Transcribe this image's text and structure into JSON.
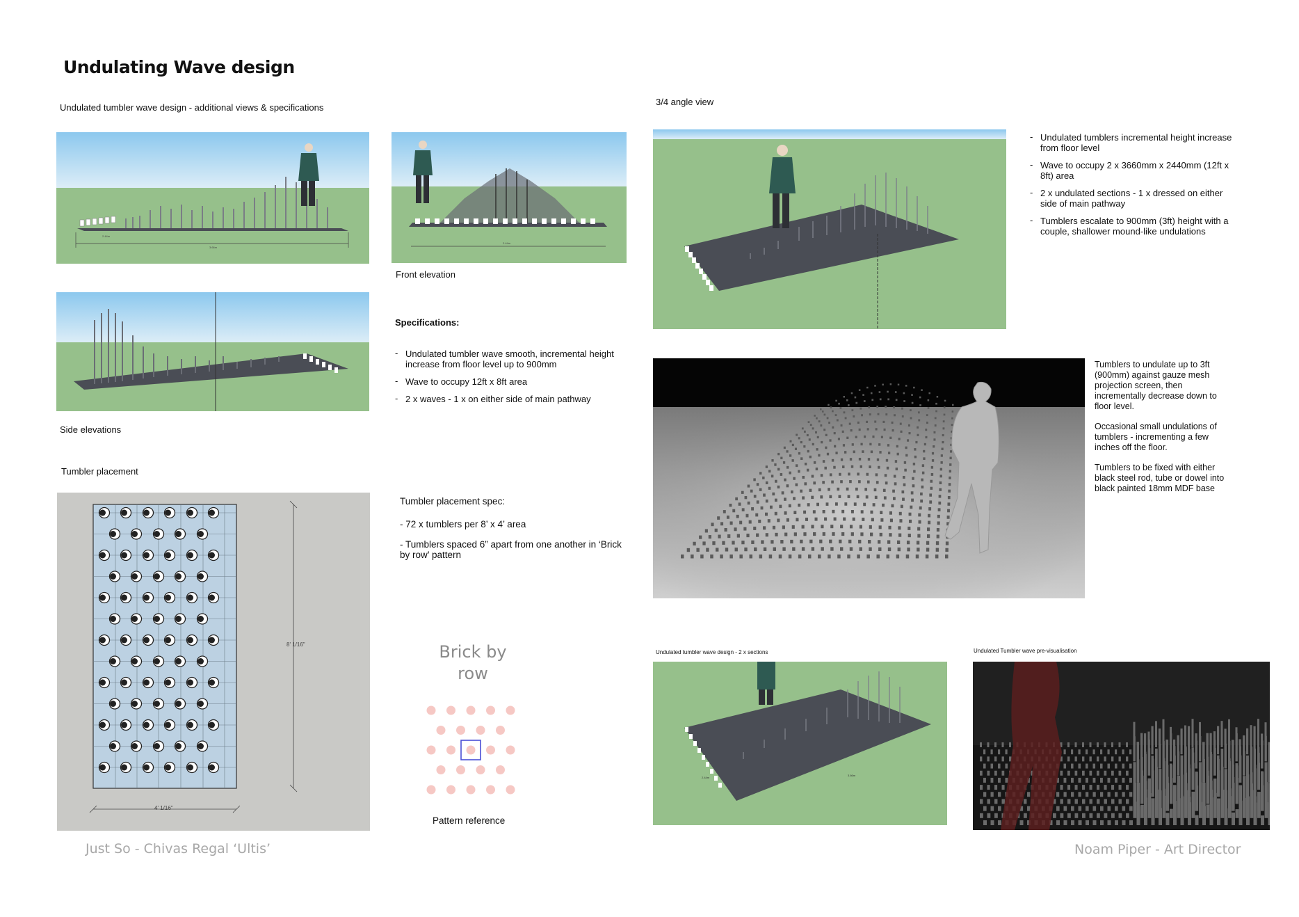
{
  "page": {
    "title": "Undulating Wave design",
    "footer_left": "Just So - Chivas Regal ‘Ultis’",
    "footer_right": "Noam Piper - Art Director"
  },
  "left_column": {
    "subtitle": "Undulated tumbler wave design - additional views & specifications",
    "front_caption": "Front elevation",
    "side_caption": "Side elevations",
    "specifications": {
      "heading": "Specifications:",
      "items": [
        "Undulated tumbler wave smooth, incremental height increase from floor level up to 900mm",
        "Wave to occupy 12ft x 8ft area",
        "2 x waves - 1 x on either side of main pathway"
      ]
    },
    "placement": {
      "heading": "Tumbler placement",
      "dim_height": "8' 1/16\"",
      "dim_width": "4' 1/16\"",
      "spec_heading": "Tumbler placement spec:",
      "spec_items": [
        "- 72 x tumblers per 8’ x 4’ area",
        "- Tumblers spaced 6” apart from one another in ‘Brick by row’ pattern"
      ],
      "pattern_title": "Brick by row",
      "pattern_caption": "Pattern reference",
      "pattern_dot_color": "#f6c8c4",
      "pattern_highlight_color": "#4a4fd6"
    },
    "dim_labels": {
      "front_small": "2.44m",
      "front_large": "3.66m",
      "elev_small": "2.44m"
    }
  },
  "right_column": {
    "angle_caption": "3/4 angle view",
    "angle_bullets": [
      "Undulated tumblers incremental height increase from floor level",
      "Wave to occupy 2 x 3660mm x 2440mm (12ft x 8ft) area",
      "2 x undulated sections - 1 x dressed on either side of main pathway",
      "Tumblers escalate to 900mm (3ft) height with a couple, shallower mound-like undulations"
    ],
    "render_notes": [
      "Tumblers to undulate up to 3ft (900mm) against gauze mesh projection screen, then incrementally decrease down to floor level.",
      "Occasional small undulations of tumblers - incrementing a few inches off the floor.",
      "Tumblers to be fixed with either black steel rod, tube or dowel into black painted 18mm MDF base"
    ],
    "sections_caption": "Undulated tumbler wave design - 2 x sections",
    "previs_caption": "Undulated Tumbler wave pre-visualisation",
    "sections_dims": [
      "2.44m",
      "3.66m"
    ]
  },
  "colors": {
    "sky_top": "#9fd0ee",
    "sky_bottom": "#d8ecf7",
    "grass": "#96c08b",
    "base": "#4a4d55",
    "plan_bg": "#c9c9c6",
    "plan_area": "#bcd1e2",
    "footer_grey": "#a8a8a8"
  }
}
